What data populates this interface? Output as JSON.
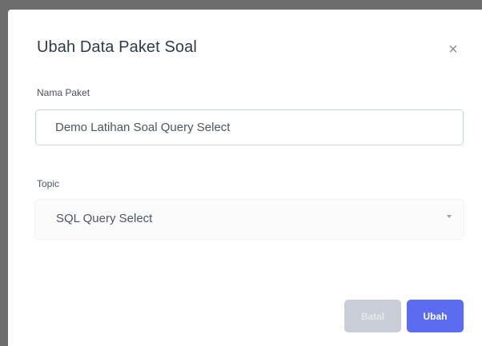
{
  "modal": {
    "title": "Ubah Data Paket Soal",
    "close_icon": "close-icon"
  },
  "form": {
    "nama_paket": {
      "label": "Nama Paket",
      "value": "Demo Latihan Soal Query Select"
    },
    "topic": {
      "label": "Topic",
      "selected": "SQL Query Select",
      "caret_icon": "caret-down-icon"
    }
  },
  "buttons": {
    "cancel_label": "Batal",
    "submit_label": "Ubah"
  },
  "colors": {
    "primary": "#5b6cf0",
    "disabled": "#c9ced6",
    "overlay": "#6d6d6d",
    "input_border": "#c8cdf4"
  }
}
